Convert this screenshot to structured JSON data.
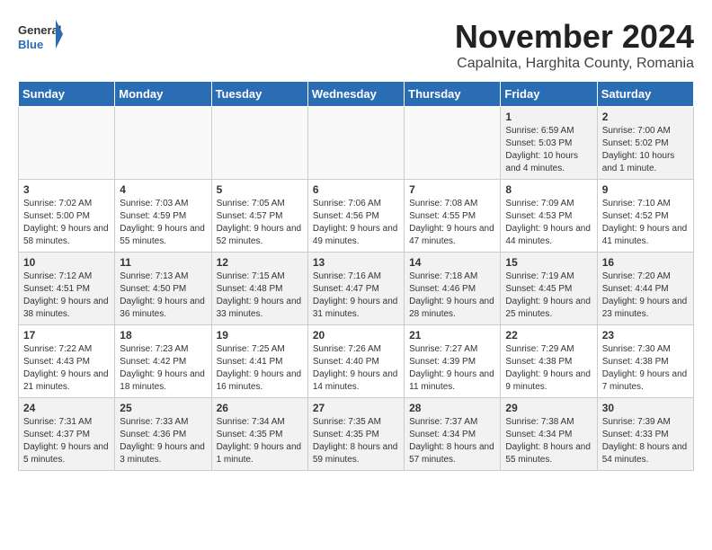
{
  "logo": {
    "line1": "General",
    "line2": "Blue"
  },
  "title": "November 2024",
  "location": "Capalnita, Harghita County, Romania",
  "days_of_week": [
    "Sunday",
    "Monday",
    "Tuesday",
    "Wednesday",
    "Thursday",
    "Friday",
    "Saturday"
  ],
  "weeks": [
    [
      {
        "day": "",
        "info": ""
      },
      {
        "day": "",
        "info": ""
      },
      {
        "day": "",
        "info": ""
      },
      {
        "day": "",
        "info": ""
      },
      {
        "day": "",
        "info": ""
      },
      {
        "day": "1",
        "info": "Sunrise: 6:59 AM\nSunset: 5:03 PM\nDaylight: 10 hours and 4 minutes."
      },
      {
        "day": "2",
        "info": "Sunrise: 7:00 AM\nSunset: 5:02 PM\nDaylight: 10 hours and 1 minute."
      }
    ],
    [
      {
        "day": "3",
        "info": "Sunrise: 7:02 AM\nSunset: 5:00 PM\nDaylight: 9 hours and 58 minutes."
      },
      {
        "day": "4",
        "info": "Sunrise: 7:03 AM\nSunset: 4:59 PM\nDaylight: 9 hours and 55 minutes."
      },
      {
        "day": "5",
        "info": "Sunrise: 7:05 AM\nSunset: 4:57 PM\nDaylight: 9 hours and 52 minutes."
      },
      {
        "day": "6",
        "info": "Sunrise: 7:06 AM\nSunset: 4:56 PM\nDaylight: 9 hours and 49 minutes."
      },
      {
        "day": "7",
        "info": "Sunrise: 7:08 AM\nSunset: 4:55 PM\nDaylight: 9 hours and 47 minutes."
      },
      {
        "day": "8",
        "info": "Sunrise: 7:09 AM\nSunset: 4:53 PM\nDaylight: 9 hours and 44 minutes."
      },
      {
        "day": "9",
        "info": "Sunrise: 7:10 AM\nSunset: 4:52 PM\nDaylight: 9 hours and 41 minutes."
      }
    ],
    [
      {
        "day": "10",
        "info": "Sunrise: 7:12 AM\nSunset: 4:51 PM\nDaylight: 9 hours and 38 minutes."
      },
      {
        "day": "11",
        "info": "Sunrise: 7:13 AM\nSunset: 4:50 PM\nDaylight: 9 hours and 36 minutes."
      },
      {
        "day": "12",
        "info": "Sunrise: 7:15 AM\nSunset: 4:48 PM\nDaylight: 9 hours and 33 minutes."
      },
      {
        "day": "13",
        "info": "Sunrise: 7:16 AM\nSunset: 4:47 PM\nDaylight: 9 hours and 31 minutes."
      },
      {
        "day": "14",
        "info": "Sunrise: 7:18 AM\nSunset: 4:46 PM\nDaylight: 9 hours and 28 minutes."
      },
      {
        "day": "15",
        "info": "Sunrise: 7:19 AM\nSunset: 4:45 PM\nDaylight: 9 hours and 25 minutes."
      },
      {
        "day": "16",
        "info": "Sunrise: 7:20 AM\nSunset: 4:44 PM\nDaylight: 9 hours and 23 minutes."
      }
    ],
    [
      {
        "day": "17",
        "info": "Sunrise: 7:22 AM\nSunset: 4:43 PM\nDaylight: 9 hours and 21 minutes."
      },
      {
        "day": "18",
        "info": "Sunrise: 7:23 AM\nSunset: 4:42 PM\nDaylight: 9 hours and 18 minutes."
      },
      {
        "day": "19",
        "info": "Sunrise: 7:25 AM\nSunset: 4:41 PM\nDaylight: 9 hours and 16 minutes."
      },
      {
        "day": "20",
        "info": "Sunrise: 7:26 AM\nSunset: 4:40 PM\nDaylight: 9 hours and 14 minutes."
      },
      {
        "day": "21",
        "info": "Sunrise: 7:27 AM\nSunset: 4:39 PM\nDaylight: 9 hours and 11 minutes."
      },
      {
        "day": "22",
        "info": "Sunrise: 7:29 AM\nSunset: 4:38 PM\nDaylight: 9 hours and 9 minutes."
      },
      {
        "day": "23",
        "info": "Sunrise: 7:30 AM\nSunset: 4:38 PM\nDaylight: 9 hours and 7 minutes."
      }
    ],
    [
      {
        "day": "24",
        "info": "Sunrise: 7:31 AM\nSunset: 4:37 PM\nDaylight: 9 hours and 5 minutes."
      },
      {
        "day": "25",
        "info": "Sunrise: 7:33 AM\nSunset: 4:36 PM\nDaylight: 9 hours and 3 minutes."
      },
      {
        "day": "26",
        "info": "Sunrise: 7:34 AM\nSunset: 4:35 PM\nDaylight: 9 hours and 1 minute."
      },
      {
        "day": "27",
        "info": "Sunrise: 7:35 AM\nSunset: 4:35 PM\nDaylight: 8 hours and 59 minutes."
      },
      {
        "day": "28",
        "info": "Sunrise: 7:37 AM\nSunset: 4:34 PM\nDaylight: 8 hours and 57 minutes."
      },
      {
        "day": "29",
        "info": "Sunrise: 7:38 AM\nSunset: 4:34 PM\nDaylight: 8 hours and 55 minutes."
      },
      {
        "day": "30",
        "info": "Sunrise: 7:39 AM\nSunset: 4:33 PM\nDaylight: 8 hours and 54 minutes."
      }
    ]
  ]
}
